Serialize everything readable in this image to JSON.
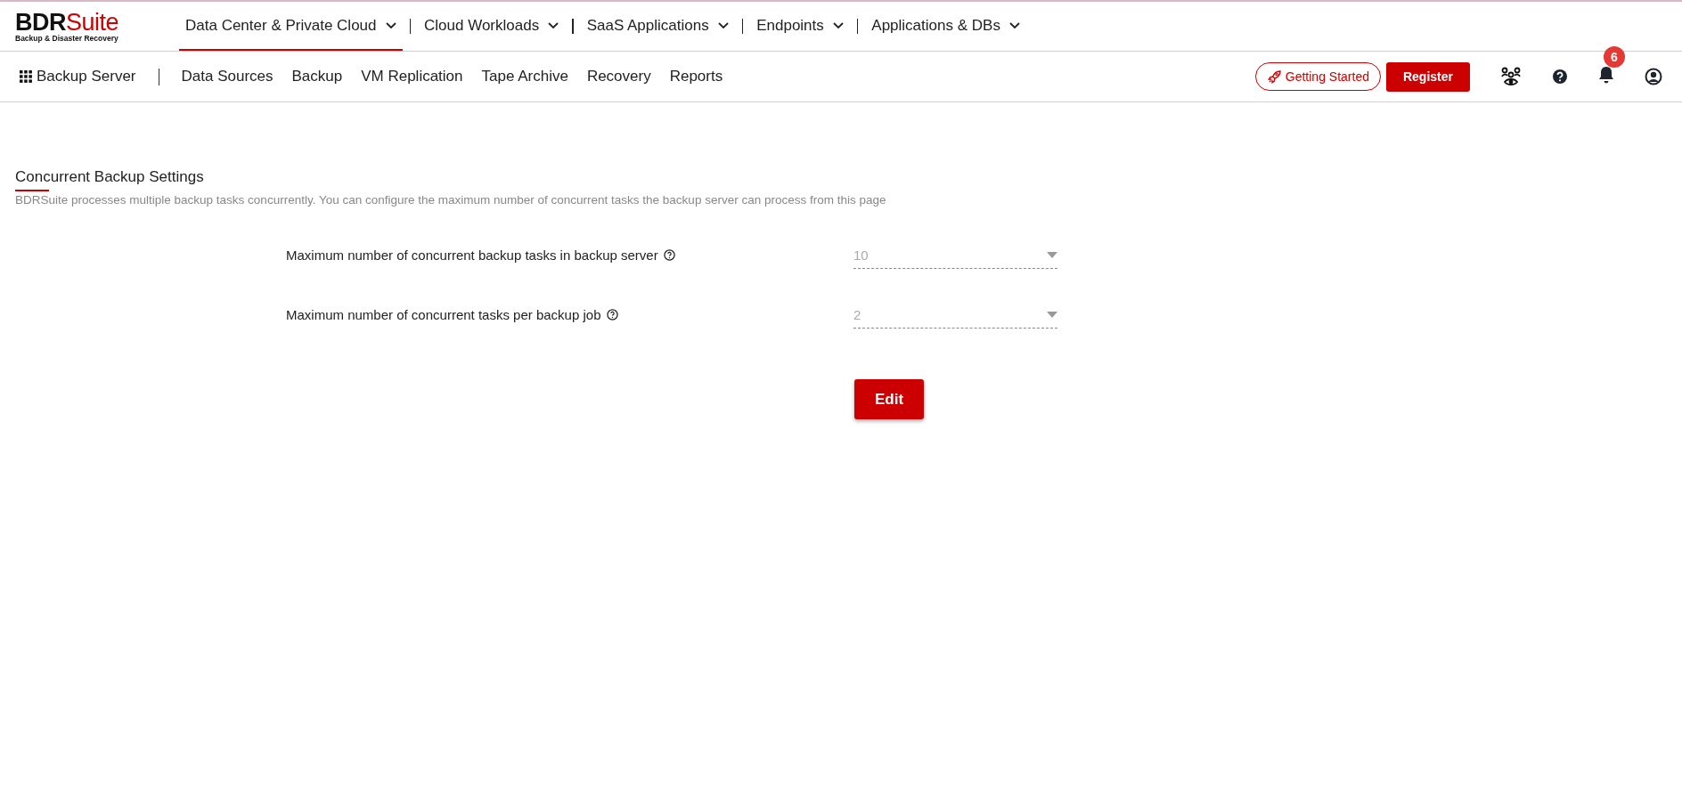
{
  "logo": {
    "prefix": "BDR",
    "suffix": "Suite",
    "tagline": "Backup & Disaster Recovery"
  },
  "top_nav": [
    {
      "label": "Data Center & Private Cloud",
      "selected": true
    },
    {
      "label": "Cloud Workloads",
      "selected": false
    },
    {
      "label": "SaaS Applications",
      "selected": false
    },
    {
      "label": "Endpoints",
      "selected": false
    },
    {
      "label": "Applications & DBs",
      "selected": false
    }
  ],
  "sub_nav": {
    "title": "Backup Server",
    "items": [
      "Data Sources",
      "Backup",
      "VM Replication",
      "Tape Archive",
      "Recovery",
      "Reports"
    ]
  },
  "actions": {
    "getting_started": "Getting Started",
    "register": "Register",
    "notification_count": "6"
  },
  "page": {
    "title": "Concurrent Backup Settings",
    "description": "BDRSuite processes multiple backup tasks concurrently. You can configure the maximum number of concurrent tasks the backup server can process from this page"
  },
  "settings": [
    {
      "label": "Maximum number of concurrent backup tasks in backup server",
      "value": "10",
      "disabled": true
    },
    {
      "label": "Maximum number of concurrent tasks per backup job",
      "value": "2",
      "disabled": true
    }
  ],
  "edit_button": "Edit"
}
